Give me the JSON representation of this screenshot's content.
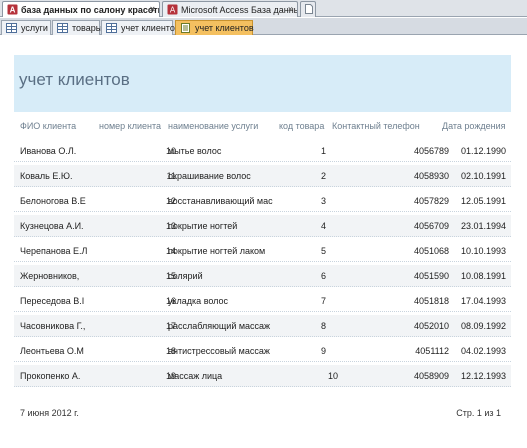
{
  "browser_tabs": [
    {
      "label": "база данных по салону красоты",
      "active": true,
      "close": "×"
    },
    {
      "label": "Microsoft Access База данных",
      "active": false,
      "close": "×"
    }
  ],
  "object_tabs": [
    {
      "label": "услуги",
      "active": false
    },
    {
      "label": "товары",
      "active": false
    },
    {
      "label": "учет клиентов",
      "active": false
    },
    {
      "label": "учет клиентов",
      "active": true
    }
  ],
  "report": {
    "title": "учет клиентов",
    "columns": [
      "ФИО клиента",
      "номер клиента",
      "наименование услуги",
      "код товара",
      "Контактный телефон",
      "Дата рождения"
    ],
    "rows": [
      {
        "fio": "Иванова О.Л.",
        "num": "10",
        "service": "мытье волос",
        "code": "1",
        "phone": "4056789",
        "birth": "01.12.1990"
      },
      {
        "fio": "Коваль Е.Ю.",
        "num": "11",
        "service": "окрашивание волос",
        "code": "2",
        "phone": "4058930",
        "birth": "02.10.1991"
      },
      {
        "fio": "Белоногова В.Е",
        "num": "12",
        "service": "восстанавливающий мас",
        "code": "3",
        "phone": "4057829",
        "birth": "12.05.1991"
      },
      {
        "fio": "Кузнецова А.И.",
        "num": "13",
        "service": "покрытие ногтей",
        "code": "4",
        "phone": "4056709",
        "birth": "23.01.1994"
      },
      {
        "fio": "Черепанова Е.Л",
        "num": "14",
        "service": "покрытие ногтей лаком",
        "code": "5",
        "phone": "4051068",
        "birth": "10.10.1993"
      },
      {
        "fio": "Жерновников,",
        "num": "15",
        "service": "солярий",
        "code": "6",
        "phone": "4051590",
        "birth": "10.08.1991"
      },
      {
        "fio": "Переседова В.I",
        "num": "16",
        "service": "укладка волос",
        "code": "7",
        "phone": "4051818",
        "birth": "17.04.1993"
      },
      {
        "fio": "Часовникова Г.,",
        "num": "17",
        "service": "расслабляющий массаж",
        "code": "8",
        "phone": "4052010",
        "birth": "08.09.1992"
      },
      {
        "fio": "Леонтьева О.М",
        "num": "18",
        "service": "антистрессовый массаж",
        "code": "9",
        "phone": "4051112",
        "birth": "04.02.1993"
      },
      {
        "fio": "Прокопенко А.",
        "num": "19",
        "service": "массаж лица",
        "code": "10",
        "phone": "4058909",
        "birth": "12.12.1993"
      }
    ],
    "footer_date": "7 июня 2012 г.",
    "footer_page": "Стр. 1 из 1"
  },
  "colors": {
    "header_band": "#d7ecf8",
    "active_object_tab": "#f4c060",
    "title_text": "#5a6f84"
  }
}
